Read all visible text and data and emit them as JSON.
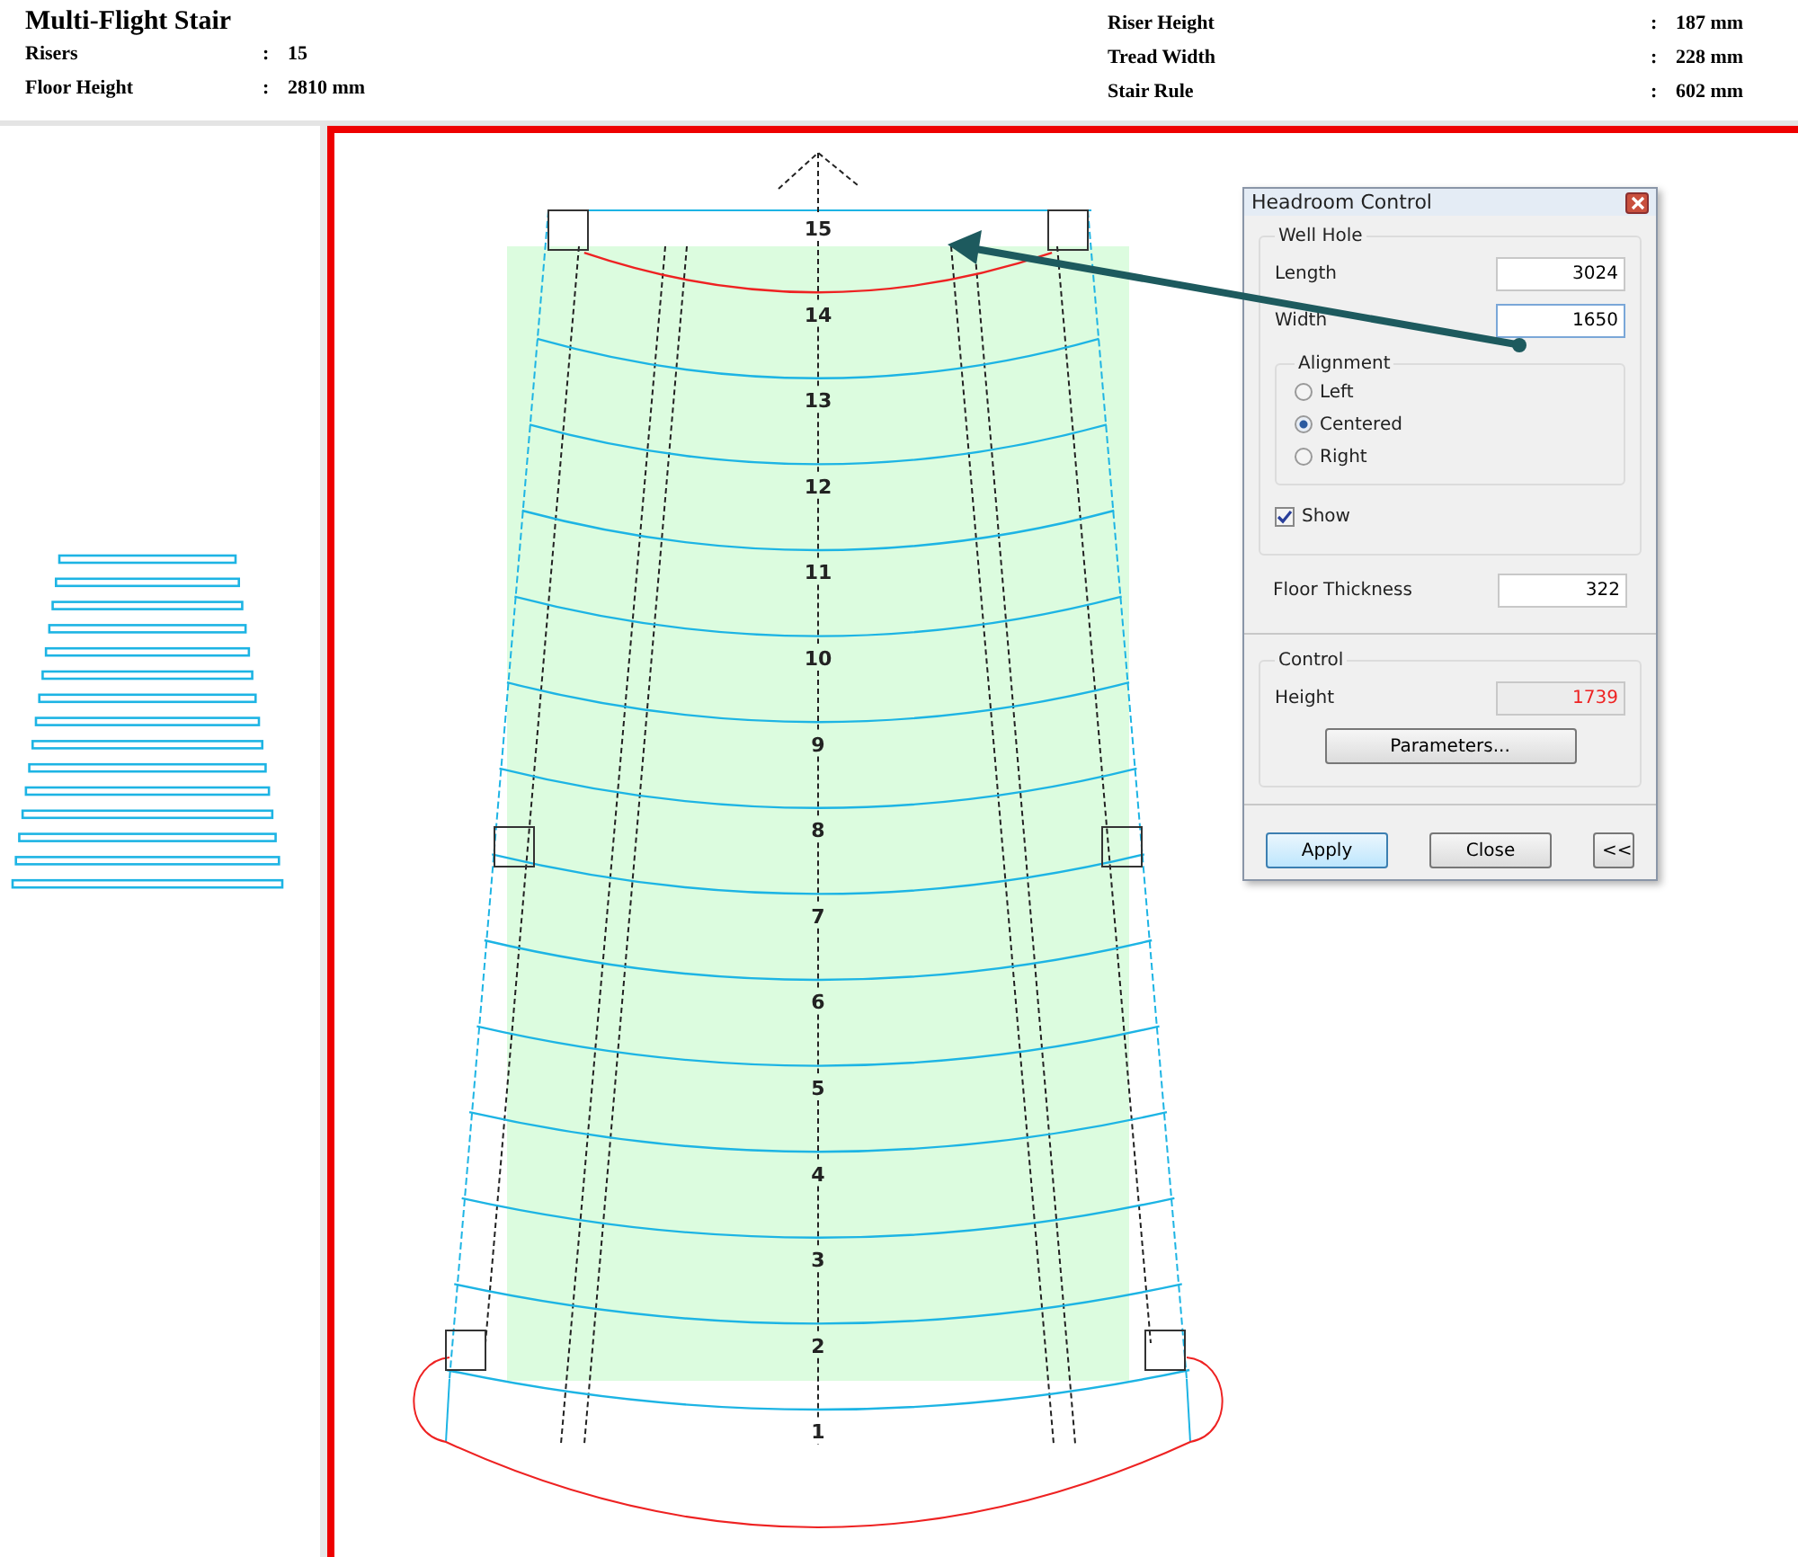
{
  "header": {
    "title": "Multi-Flight Stair",
    "left_fields": [
      {
        "label": "Risers",
        "separator": ":",
        "value": "15"
      },
      {
        "label": "Floor Height",
        "separator": ":",
        "value": "2810 mm"
      }
    ],
    "right_fields": [
      {
        "label": "Riser Height",
        "separator": ":",
        "value": "187 mm"
      },
      {
        "label": "Tread Width",
        "separator": ":",
        "value": "228 mm"
      },
      {
        "label": "Stair Rule",
        "separator": ":",
        "value": "602 mm"
      }
    ]
  },
  "plan": {
    "steps": [
      "15",
      "14",
      "13",
      "12",
      "11",
      "10",
      "9",
      "8",
      "7",
      "6",
      "5",
      "4",
      "3",
      "2",
      "1"
    ],
    "tread_lines": [
      {
        "conflict": true
      },
      {
        "conflict": false
      },
      {
        "conflict": false
      },
      {
        "conflict": false
      },
      {
        "conflict": false
      },
      {
        "conflict": false
      },
      {
        "conflict": false
      },
      {
        "conflict": false
      },
      {
        "conflict": false
      },
      {
        "conflict": false
      },
      {
        "conflict": false
      },
      {
        "conflict": false
      },
      {
        "conflict": false
      },
      {
        "conflict": false
      }
    ]
  },
  "dialog": {
    "title": "Headroom Control",
    "well_hole": {
      "title": "Well Hole",
      "length": {
        "label": "Length",
        "value": "3024"
      },
      "width": {
        "label": "Width",
        "value": "1650"
      },
      "alignment": {
        "title": "Alignment",
        "options": [
          {
            "label": "Left",
            "selected": false
          },
          {
            "label": "Centered",
            "selected": true
          },
          {
            "label": "Right",
            "selected": false
          }
        ]
      },
      "show": {
        "label": "Show",
        "checked": true
      }
    },
    "floor_thickness": {
      "label": "Floor Thickness",
      "value": "322"
    },
    "control": {
      "title": "Control",
      "height": {
        "label": "Height",
        "value": "1739"
      },
      "parameters_button": "Parameters..."
    },
    "buttons": [
      {
        "label": "Apply",
        "kind": "default"
      },
      {
        "label": "Close",
        "kind": "normal"
      },
      {
        "label": "<<",
        "kind": "small"
      }
    ]
  }
}
